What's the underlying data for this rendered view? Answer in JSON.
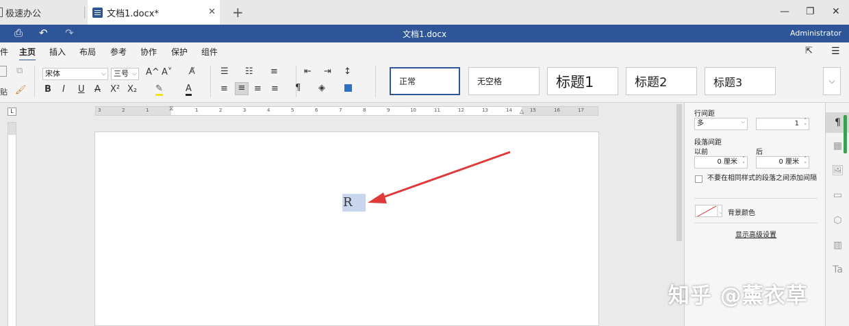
{
  "tabs": [
    {
      "label": "极速办公"
    },
    {
      "label": "文档1.docx*"
    }
  ],
  "titlebar": {
    "doc_title": "文档1.docx",
    "user": "Administrator"
  },
  "menu": {
    "file_fragment": "件",
    "items": [
      "主页",
      "插入",
      "布局",
      "参考",
      "协作",
      "保护",
      "组件"
    ],
    "active": "主页"
  },
  "ribbon": {
    "paste_fragment": "贴",
    "font_name": "宋体",
    "font_size": "三号",
    "bold": "B",
    "italic": "I",
    "underline": "U",
    "strike": "A",
    "superscript": "X²",
    "subscript": "X₂",
    "grow": "A^",
    "shrink": "A˅",
    "font_color": "A",
    "pilcrow": "¶"
  },
  "styles": [
    {
      "label": "正常",
      "selected": true
    },
    {
      "label": "无空格",
      "selected": false
    },
    {
      "label": "标题1",
      "selected": false
    },
    {
      "label": "标题2",
      "selected": false
    },
    {
      "label": "标题3",
      "selected": false
    }
  ],
  "ruler": {
    "ticks": [
      "3",
      "2",
      "1",
      "1",
      "2",
      "3",
      "4",
      "5",
      "6",
      "7",
      "8",
      "9",
      "10",
      "11",
      "12",
      "13",
      "14",
      "15",
      "16",
      "17"
    ]
  },
  "document": {
    "selected_text": "R"
  },
  "panel": {
    "line_spacing_label": "行间距",
    "line_spacing_type": "多",
    "line_spacing_value": "1",
    "para_spacing_label": "段落间距",
    "before_label": "以前",
    "after_label": "后",
    "before_value": "0 厘米",
    "after_value": "0 厘米",
    "no_space_same_style": "不要在相同样式的段落之间添加间隔",
    "bg_color_label": "背景颜色",
    "advanced_link": "显示高级设置"
  },
  "watermark": "知乎 @薰衣草",
  "colors": {
    "accent": "#2d5597",
    "selection": "#c9d7ee",
    "arrow": "#e03a3a",
    "scroll_indicator": "#3aa052"
  }
}
